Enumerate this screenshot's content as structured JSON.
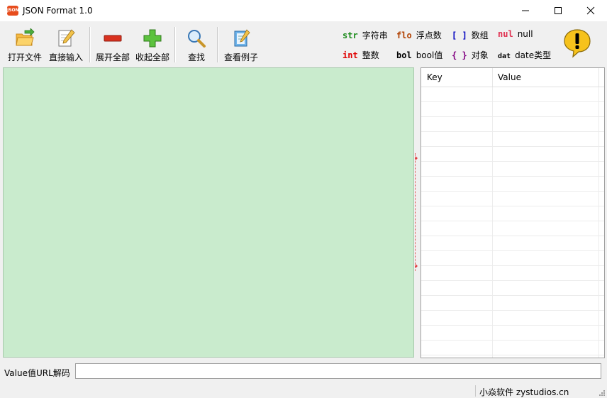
{
  "window": {
    "app_icon_text": "JSON",
    "title": "JSON Format 1.0",
    "minimize_label": "—",
    "maximize_label": "☐",
    "close_label": "✕"
  },
  "toolbar": {
    "open_file": "打开文件",
    "direct_input": "直接输入",
    "expand_all": "展开全部",
    "collapse_all": "收起全部",
    "find": "查找",
    "view_example": "查看例子"
  },
  "legend": {
    "items": [
      {
        "tag": "str",
        "label": "字符串",
        "color": "#1a8a1a"
      },
      {
        "tag": "flo",
        "label": "浮点数",
        "color": "#b04000"
      },
      {
        "tag": "[ ]",
        "label": "数组",
        "color": "#0000c0"
      },
      {
        "tag": "nul",
        "label": "null",
        "color": "#e03050"
      },
      {
        "tag": "int",
        "label": "整数",
        "color": "#e00000"
      },
      {
        "tag": "bol",
        "label": "bool值",
        "color": "#000000"
      },
      {
        "tag": "{ }",
        "label": "对象",
        "color": "#800080"
      },
      {
        "tag": "dat",
        "label": "date类型",
        "color": "#000000"
      }
    ]
  },
  "grid": {
    "col_key": "Key",
    "col_value": "Value"
  },
  "url_decode": {
    "label": "Value值URL解码",
    "value": ""
  },
  "status": {
    "text": "小焱软件 zystudios.cn"
  },
  "colors": {
    "tree_bg": "#c9ebcd",
    "titlebar": "#ffffff"
  }
}
